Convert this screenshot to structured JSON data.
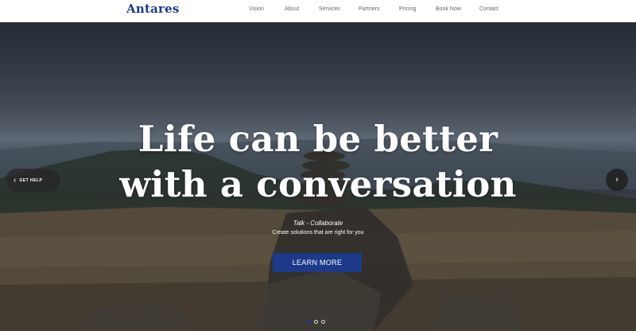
{
  "header": {
    "brand": "Antares",
    "nav": [
      "Vision",
      "About",
      "Services",
      "Partners",
      "Pricing",
      "Book Now",
      "Contact"
    ]
  },
  "hero": {
    "headline_line1": "Life can be better",
    "headline_line2": "with a conversation",
    "tagline": "Talk - Collaborate",
    "subtext": "Create solutions that are right for you",
    "cta_label": "LEARN MORE",
    "help_label": "GET HELP",
    "prev_icon": "chevron-left-icon",
    "next_icon": "chevron-right-icon",
    "slides_count": 3,
    "active_slide": 1
  },
  "colors": {
    "brand": "#1d3a8a",
    "header_bg": "#ffffff",
    "nav_text": "#666666",
    "hero_text": "#ffffff"
  }
}
